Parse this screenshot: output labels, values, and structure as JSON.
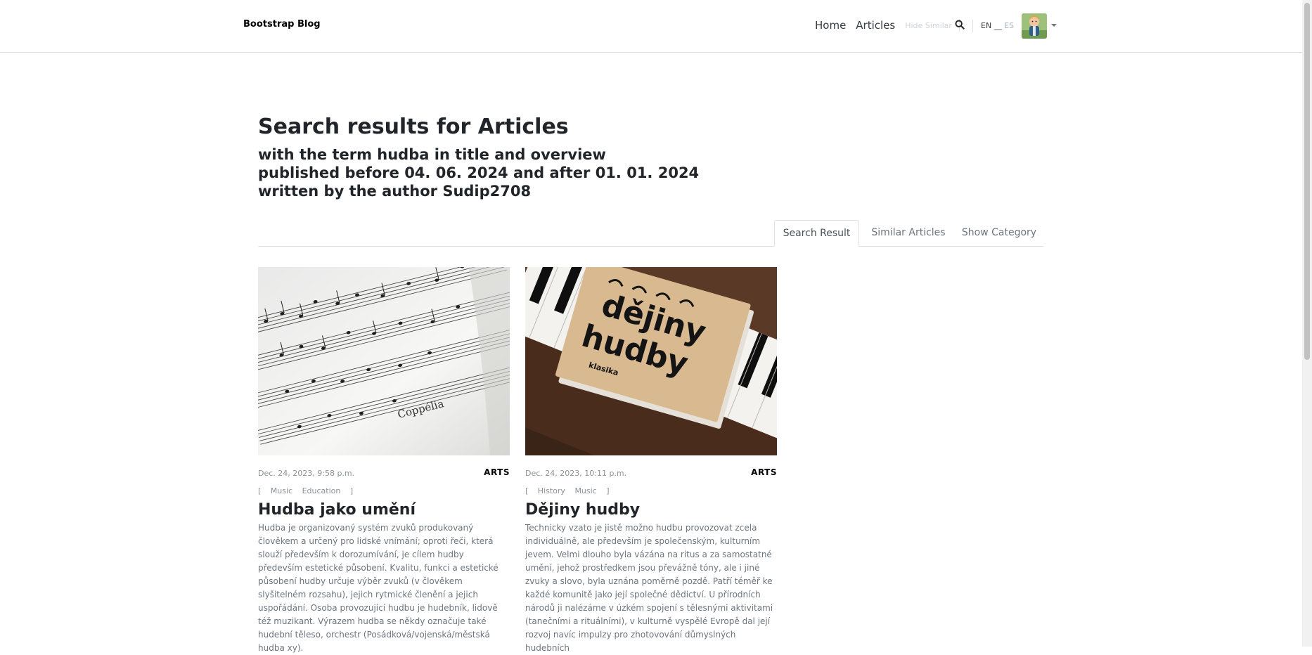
{
  "navbar": {
    "brand": "Bootstrap Blog",
    "links": [
      "Home",
      "Articles"
    ],
    "hide_similar": "Hide Similar",
    "lang_en": "EN",
    "lang_sep": "__",
    "lang_es": "ES",
    "icons": {
      "search": "search-icon",
      "avatar": "avatar",
      "caret": "caret-down-icon"
    }
  },
  "header": {
    "title": "Search results for Articles",
    "line1": "with the term hudba in title and overview",
    "line2": "published before 04. 06. 2024 and after 01. 01. 2024",
    "line3": "written by the author Sudip2708"
  },
  "tabs": [
    {
      "label": "Search Result",
      "active": true
    },
    {
      "label": "Similar Articles",
      "active": false
    },
    {
      "label": "Show Category",
      "active": false
    }
  ],
  "articles": [
    {
      "date": "Dec. 24, 2023, 9:58 p.m.",
      "category": "ARTS",
      "tags": [
        "Music",
        "Education"
      ],
      "title": "Hudba jako umění",
      "overview": "Hudba je organizovaný systém zvuků produkovaný člověkem a určený pro lidské vnímání; oproti řeči, která slouží především k dorozumívání, je cílem hudby především estetické působení. Kvalitu, funkci a estetické působení hudby určuje výběr zvuků (v člověkem slyšitelném rozsahu), jejich rytmické členění a jejich uspořádání. Osoba provozující hudbu je hudebník, lidově též muzikant. Výrazem hudba se někdy označuje také hudební těleso, orchestr (Posádková/vojenská/městská hudba xy)."
    },
    {
      "date": "Dec. 24, 2023, 10:11 p.m.",
      "category": "ARTS",
      "tags": [
        "History",
        "Music"
      ],
      "title": "Dějiny hudby",
      "overview": "Technicky vzato je jistě možno hudbu provozovat zcela individuálně, ale především je společenským, kulturním jevem. Velmi dlouho byla vázána na ritus a za samostatné umění, jehož prostředkem jsou převážně tóny, ale i jiné zvuky a slovo, byla uznána poměrně pozdě. Patří téměř ke každé komunitě jako její společné dědictví. U přírodních národů ji nalézáme v úzkém spojení s tělesnými aktivitami (tanečními a rituálními), v kulturně vyspělé Evropě dal její rozvoj navíc impulzy pro zhotovování důmyslných hudebních"
    }
  ],
  "images": {
    "article_1": "sheet-music-photo",
    "article_2": "book-on-piano-photo",
    "book_cover_title_1": "dějiny",
    "book_cover_title_2": "hudby",
    "book_cover_sub": "klasika",
    "sheet_text": "Coppélia"
  }
}
